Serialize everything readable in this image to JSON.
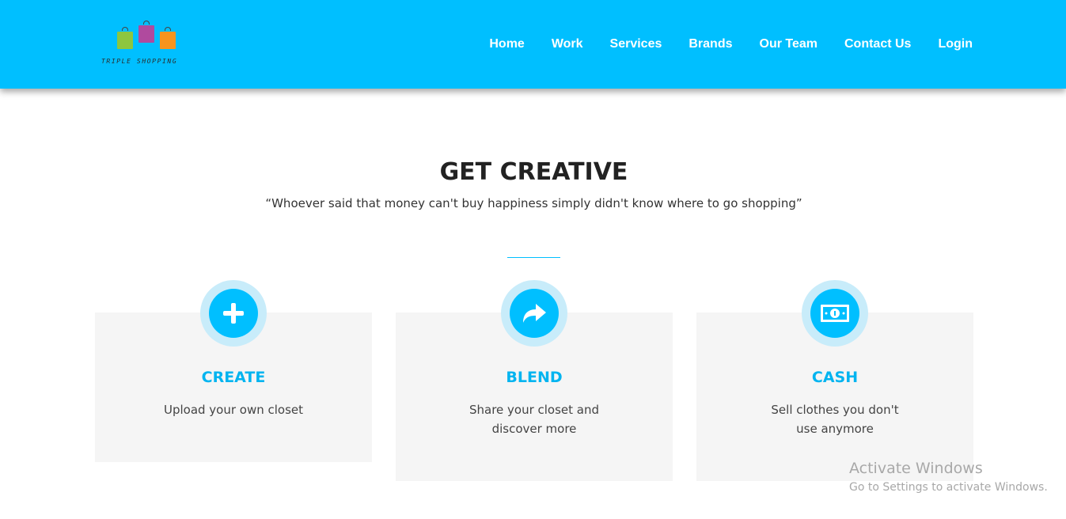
{
  "header": {
    "logo_text": "TRIPLE SHOPPING",
    "nav": [
      "Home",
      "Work",
      "Services",
      "Brands",
      "Our Team",
      "Contact Us",
      "Login"
    ]
  },
  "hero": {
    "title": "GET CREATIVE",
    "quote": "“Whoever said that money can't buy happiness simply didn't know where to go shopping”"
  },
  "features": [
    {
      "icon": "plus-icon",
      "title": "CREATE",
      "lines": [
        "Upload your own closet"
      ]
    },
    {
      "icon": "share-arrow-icon",
      "title": "BLEND",
      "lines": [
        "Share your closet and",
        "discover more"
      ]
    },
    {
      "icon": "money-bill-icon",
      "title": "CASH",
      "lines": [
        "Sell clothes you don't",
        "use anymore"
      ]
    }
  ],
  "watermark": {
    "title": "Activate Windows",
    "subtitle": "Go to Settings to activate Windows."
  },
  "colors": {
    "header_bg": "#00bfff",
    "accent": "#00b4f0",
    "card_bg": "#f5f5f5",
    "icon_ring": "#c8ecfa"
  }
}
